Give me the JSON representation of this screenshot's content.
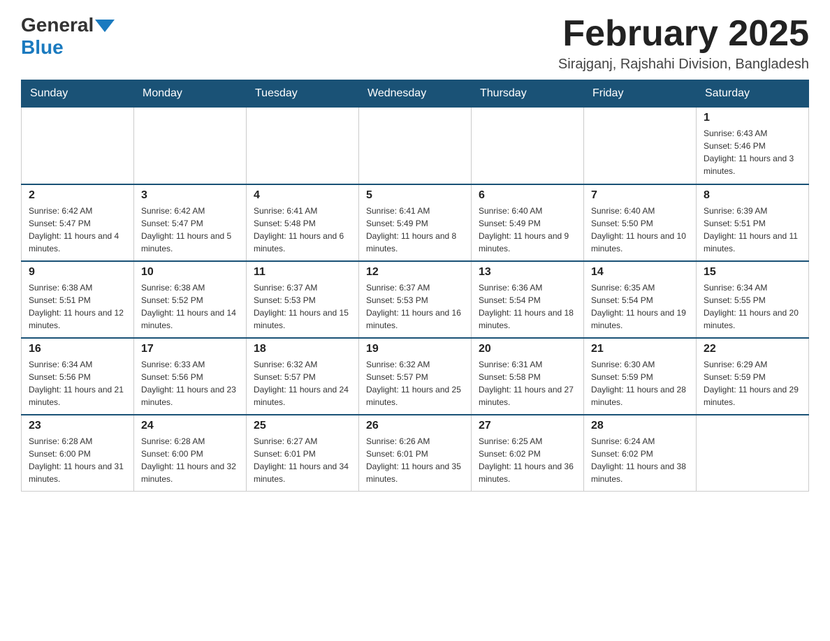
{
  "header": {
    "logo_general": "General",
    "logo_blue": "Blue",
    "month_title": "February 2025",
    "location": "Sirajganj, Rajshahi Division, Bangladesh"
  },
  "days_of_week": [
    "Sunday",
    "Monday",
    "Tuesday",
    "Wednesday",
    "Thursday",
    "Friday",
    "Saturday"
  ],
  "accent_color": "#1a5276",
  "weeks": [
    [
      {
        "day": "",
        "sunrise": "",
        "sunset": "",
        "daylight": ""
      },
      {
        "day": "",
        "sunrise": "",
        "sunset": "",
        "daylight": ""
      },
      {
        "day": "",
        "sunrise": "",
        "sunset": "",
        "daylight": ""
      },
      {
        "day": "",
        "sunrise": "",
        "sunset": "",
        "daylight": ""
      },
      {
        "day": "",
        "sunrise": "",
        "sunset": "",
        "daylight": ""
      },
      {
        "day": "",
        "sunrise": "",
        "sunset": "",
        "daylight": ""
      },
      {
        "day": "1",
        "sunrise": "Sunrise: 6:43 AM",
        "sunset": "Sunset: 5:46 PM",
        "daylight": "Daylight: 11 hours and 3 minutes."
      }
    ],
    [
      {
        "day": "2",
        "sunrise": "Sunrise: 6:42 AM",
        "sunset": "Sunset: 5:47 PM",
        "daylight": "Daylight: 11 hours and 4 minutes."
      },
      {
        "day": "3",
        "sunrise": "Sunrise: 6:42 AM",
        "sunset": "Sunset: 5:47 PM",
        "daylight": "Daylight: 11 hours and 5 minutes."
      },
      {
        "day": "4",
        "sunrise": "Sunrise: 6:41 AM",
        "sunset": "Sunset: 5:48 PM",
        "daylight": "Daylight: 11 hours and 6 minutes."
      },
      {
        "day": "5",
        "sunrise": "Sunrise: 6:41 AM",
        "sunset": "Sunset: 5:49 PM",
        "daylight": "Daylight: 11 hours and 8 minutes."
      },
      {
        "day": "6",
        "sunrise": "Sunrise: 6:40 AM",
        "sunset": "Sunset: 5:49 PM",
        "daylight": "Daylight: 11 hours and 9 minutes."
      },
      {
        "day": "7",
        "sunrise": "Sunrise: 6:40 AM",
        "sunset": "Sunset: 5:50 PM",
        "daylight": "Daylight: 11 hours and 10 minutes."
      },
      {
        "day": "8",
        "sunrise": "Sunrise: 6:39 AM",
        "sunset": "Sunset: 5:51 PM",
        "daylight": "Daylight: 11 hours and 11 minutes."
      }
    ],
    [
      {
        "day": "9",
        "sunrise": "Sunrise: 6:38 AM",
        "sunset": "Sunset: 5:51 PM",
        "daylight": "Daylight: 11 hours and 12 minutes."
      },
      {
        "day": "10",
        "sunrise": "Sunrise: 6:38 AM",
        "sunset": "Sunset: 5:52 PM",
        "daylight": "Daylight: 11 hours and 14 minutes."
      },
      {
        "day": "11",
        "sunrise": "Sunrise: 6:37 AM",
        "sunset": "Sunset: 5:53 PM",
        "daylight": "Daylight: 11 hours and 15 minutes."
      },
      {
        "day": "12",
        "sunrise": "Sunrise: 6:37 AM",
        "sunset": "Sunset: 5:53 PM",
        "daylight": "Daylight: 11 hours and 16 minutes."
      },
      {
        "day": "13",
        "sunrise": "Sunrise: 6:36 AM",
        "sunset": "Sunset: 5:54 PM",
        "daylight": "Daylight: 11 hours and 18 minutes."
      },
      {
        "day": "14",
        "sunrise": "Sunrise: 6:35 AM",
        "sunset": "Sunset: 5:54 PM",
        "daylight": "Daylight: 11 hours and 19 minutes."
      },
      {
        "day": "15",
        "sunrise": "Sunrise: 6:34 AM",
        "sunset": "Sunset: 5:55 PM",
        "daylight": "Daylight: 11 hours and 20 minutes."
      }
    ],
    [
      {
        "day": "16",
        "sunrise": "Sunrise: 6:34 AM",
        "sunset": "Sunset: 5:56 PM",
        "daylight": "Daylight: 11 hours and 21 minutes."
      },
      {
        "day": "17",
        "sunrise": "Sunrise: 6:33 AM",
        "sunset": "Sunset: 5:56 PM",
        "daylight": "Daylight: 11 hours and 23 minutes."
      },
      {
        "day": "18",
        "sunrise": "Sunrise: 6:32 AM",
        "sunset": "Sunset: 5:57 PM",
        "daylight": "Daylight: 11 hours and 24 minutes."
      },
      {
        "day": "19",
        "sunrise": "Sunrise: 6:32 AM",
        "sunset": "Sunset: 5:57 PM",
        "daylight": "Daylight: 11 hours and 25 minutes."
      },
      {
        "day": "20",
        "sunrise": "Sunrise: 6:31 AM",
        "sunset": "Sunset: 5:58 PM",
        "daylight": "Daylight: 11 hours and 27 minutes."
      },
      {
        "day": "21",
        "sunrise": "Sunrise: 6:30 AM",
        "sunset": "Sunset: 5:59 PM",
        "daylight": "Daylight: 11 hours and 28 minutes."
      },
      {
        "day": "22",
        "sunrise": "Sunrise: 6:29 AM",
        "sunset": "Sunset: 5:59 PM",
        "daylight": "Daylight: 11 hours and 29 minutes."
      }
    ],
    [
      {
        "day": "23",
        "sunrise": "Sunrise: 6:28 AM",
        "sunset": "Sunset: 6:00 PM",
        "daylight": "Daylight: 11 hours and 31 minutes."
      },
      {
        "day": "24",
        "sunrise": "Sunrise: 6:28 AM",
        "sunset": "Sunset: 6:00 PM",
        "daylight": "Daylight: 11 hours and 32 minutes."
      },
      {
        "day": "25",
        "sunrise": "Sunrise: 6:27 AM",
        "sunset": "Sunset: 6:01 PM",
        "daylight": "Daylight: 11 hours and 34 minutes."
      },
      {
        "day": "26",
        "sunrise": "Sunrise: 6:26 AM",
        "sunset": "Sunset: 6:01 PM",
        "daylight": "Daylight: 11 hours and 35 minutes."
      },
      {
        "day": "27",
        "sunrise": "Sunrise: 6:25 AM",
        "sunset": "Sunset: 6:02 PM",
        "daylight": "Daylight: 11 hours and 36 minutes."
      },
      {
        "day": "28",
        "sunrise": "Sunrise: 6:24 AM",
        "sunset": "Sunset: 6:02 PM",
        "daylight": "Daylight: 11 hours and 38 minutes."
      },
      {
        "day": "",
        "sunrise": "",
        "sunset": "",
        "daylight": ""
      }
    ]
  ]
}
